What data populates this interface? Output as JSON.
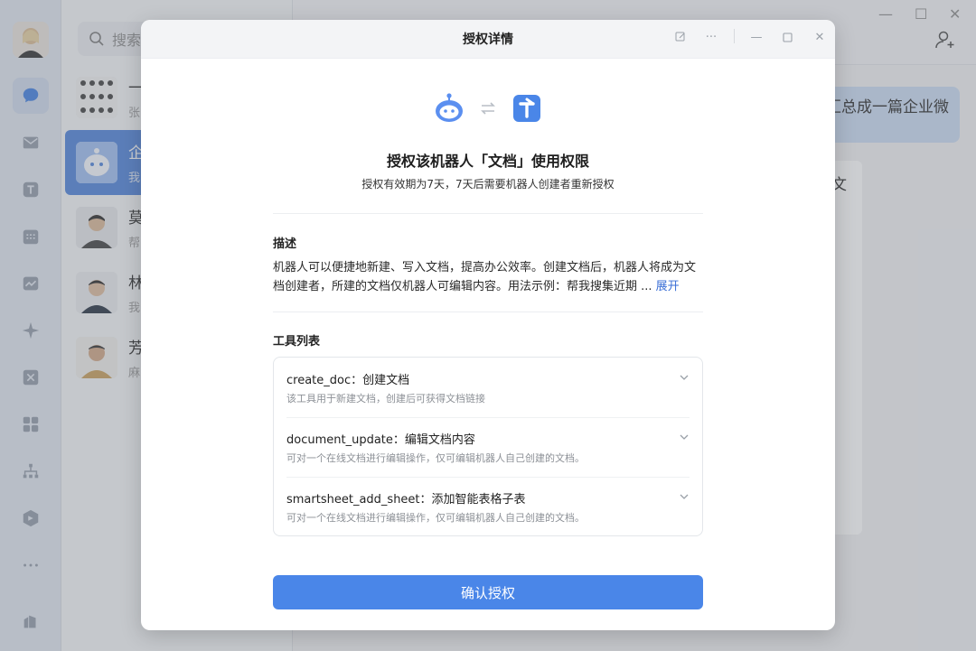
{
  "background": {
    "search_placeholder": "搜索",
    "conversations": [
      {
        "name": "一",
        "preview": "张"
      },
      {
        "name": "企",
        "preview": "我"
      },
      {
        "name": "莫",
        "preview": "帮"
      },
      {
        "name": "林",
        "preview": "我"
      },
      {
        "name": "芳",
        "preview": "麻"
      }
    ],
    "chat_bubble_text": "汇总成一篇企业微",
    "chat_card_text": "文"
  },
  "dialog": {
    "title": "授权详情",
    "heading": "授权该机器人「文档」使用权限",
    "subheading": "授权有效期为7天，7天后需要机器人创建者重新授权",
    "description_label": "描述",
    "description_text": "机器人可以便捷地新建、写入文档，提高办公效率。创建文档后，机器人将成为文档创建者，所建的文档仅机器人可编辑内容。用法示例：帮我搜集近期 ...",
    "expand_label": "展开",
    "tools_label": "工具列表",
    "tools": [
      {
        "name": "create_doc：创建文档",
        "desc": "该工具用于新建文档，创建后可获得文档链接"
      },
      {
        "name": "document_update：编辑文档内容",
        "desc": "可对一个在线文档进行编辑操作，仅可编辑机器人自己创建的文档。"
      },
      {
        "name": "smartsheet_add_sheet：添加智能表格子表",
        "desc": "可对一个在线文档进行编辑操作，仅可编辑机器人自己创建的文档。"
      }
    ],
    "confirm_label": "确认授权"
  },
  "colors": {
    "accent": "#4a86e8",
    "bot_icon": "#5b8ff0",
    "doc_icon": "#4a86e8"
  }
}
